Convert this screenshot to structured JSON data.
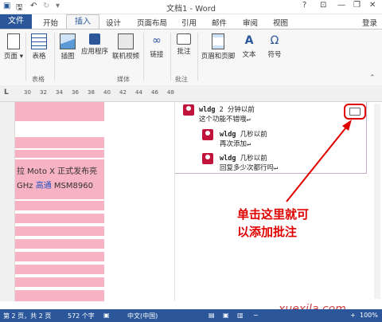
{
  "titlebar": {
    "title": "文档1 - Word",
    "help": "?",
    "minimize": "—",
    "restore": "❐",
    "close": "✕"
  },
  "tabs": {
    "file": "文件",
    "home": "开始",
    "insert": "插入",
    "design": "设计",
    "layout": "页面布局",
    "references": "引用",
    "mailings": "邮件",
    "review": "审阅",
    "view": "视图",
    "login": "登录"
  },
  "ribbon": {
    "page": "页面",
    "table": "表格",
    "illustrations": "插图",
    "apps": "应用程序",
    "online_video": "联机视频",
    "link": "链接",
    "comment": "批注",
    "header_footer": "页眉和页脚",
    "text": "文本",
    "symbol": "符号",
    "group_table": "表格",
    "group_media": "媒体",
    "group_comment": "批注"
  },
  "ruler": {
    "ticks": [
      "30",
      "32",
      "34",
      "36",
      "38",
      "40",
      "42",
      "44",
      "46",
      "48"
    ]
  },
  "document": {
    "line1": "拉 Moto X 正式发布亮",
    "line2_a": "GHz ",
    "line2_b": "高通",
    "line2_c": " MSM8960"
  },
  "comments": [
    {
      "author": "wldg",
      "meta": "2 分钟以前",
      "text": "这个功能不错哦↵"
    },
    {
      "author": "wldg",
      "meta": "几秒以前",
      "text": "再次添加↵"
    },
    {
      "author": "wldg",
      "meta": "几秒以前",
      "text": "回复多少次都行吗↵"
    }
  ],
  "annotation": {
    "line1": "单击这里就可",
    "line2": "以添加批注"
  },
  "statusbar": {
    "page": "第 2 页，共 2 页",
    "words": "572 个字",
    "lang": "中文(中国)",
    "zoom": "100%"
  },
  "watermark": "xuexila.com",
  "colors": {
    "accent": "#2b579a",
    "highlight": "#f7b2c4",
    "annotation": "#e00000",
    "avatar": "#c0143c"
  }
}
